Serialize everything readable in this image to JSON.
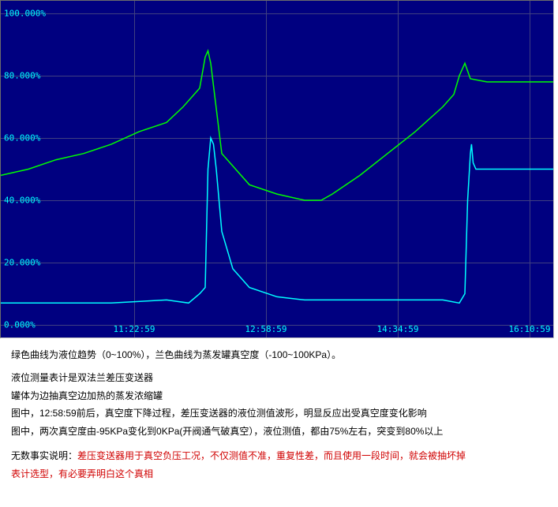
{
  "chart_data": {
    "type": "line",
    "title": "",
    "xlabel": "",
    "ylabel": "",
    "ylim": [
      0,
      100
    ],
    "y_ticks": [
      "0.000%",
      "20.000%",
      "40.000%",
      "60.000%",
      "80.000%",
      "100.000%"
    ],
    "x_ticks": [
      "11:22:59",
      "12:58:59",
      "14:34:59",
      "16:10:59"
    ],
    "series": [
      {
        "name": "液位趋势 (0~100%)",
        "color": "#00ff00",
        "x": [
          0,
          5,
          10,
          15,
          20,
          25,
          30,
          33,
          36,
          37,
          37.5,
          38,
          40,
          45,
          50,
          55,
          58,
          60,
          65,
          70,
          75,
          80,
          82,
          83,
          84,
          85,
          88,
          92,
          95,
          100
        ],
        "values": [
          48,
          50,
          53,
          55,
          58,
          62,
          65,
          70,
          76,
          86,
          88,
          84,
          55,
          45,
          42,
          40,
          40,
          42,
          48,
          55,
          62,
          70,
          74,
          80,
          84,
          79,
          78,
          78,
          78,
          78
        ]
      },
      {
        "name": "蒸发罐真空度 (-100~100KPa)",
        "color": "#00ffff",
        "x": [
          0,
          10,
          20,
          30,
          34,
          36,
          37,
          37.5,
          38,
          38.5,
          39,
          40,
          42,
          45,
          50,
          55,
          60,
          65,
          70,
          75,
          80,
          83,
          84,
          84.5,
          85,
          85.2,
          85.5,
          86,
          90,
          95,
          100
        ],
        "values": [
          7,
          7,
          7,
          8,
          7,
          10,
          12,
          50,
          60,
          58,
          50,
          30,
          18,
          12,
          9,
          8,
          8,
          8,
          8,
          8,
          8,
          7,
          10,
          40,
          55,
          58,
          52,
          50,
          50,
          50,
          50
        ]
      }
    ]
  },
  "text": {
    "l1": "绿色曲线为液位趋势（0~100%），兰色曲线为蒸发罐真空度（-100~100KPa）。",
    "l2": "液位测量表计是双法兰差压变送器",
    "l3": "罐体为边抽真空边加热的蒸发浓缩罐",
    "l4": "图中，12:58:59前后，真空度下降过程，差压变送器的液位测值波形，明显反应出受真空度变化影响",
    "l5": "图中，两次真空度由-95KPa变化到0KPa(开阀通气破真空），液位测值，都由75%左右，突变到80%以上",
    "l6a": "无数事实说明：",
    "l6b": "差压变送器用于真空负压工况，不仅测值不准，重复性差，而且使用一段时间，就会被抽坏掉",
    "l7a": "表计选型，有必要弄明白这个真相"
  }
}
